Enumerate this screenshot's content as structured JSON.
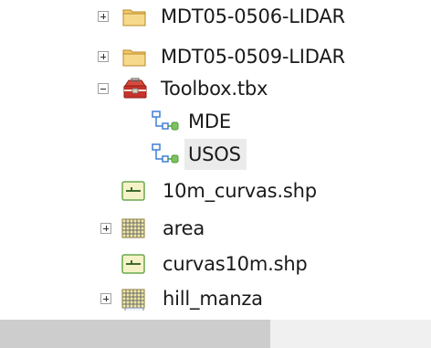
{
  "tree": {
    "items": [
      {
        "label": "MDT05-0506-LIDAR",
        "icon": "folder-icon",
        "expander": "plus"
      },
      {
        "label": "MDT05-0509-LIDAR",
        "icon": "folder-icon",
        "expander": "plus"
      },
      {
        "label": "Toolbox.tbx",
        "icon": "toolbox-icon",
        "expander": "minus"
      },
      {
        "label": "MDE",
        "icon": "model-icon",
        "expander": "none"
      },
      {
        "label": "USOS",
        "icon": "model-icon",
        "expander": "none",
        "selected": true
      },
      {
        "label": "10m_curvas.shp",
        "icon": "line-shapefile-icon",
        "expander": "none"
      },
      {
        "label": "area",
        "icon": "raster-icon",
        "expander": "plus"
      },
      {
        "label": "curvas10m.shp",
        "icon": "line-shapefile-icon",
        "expander": "none"
      },
      {
        "label": "hill_manza",
        "icon": "raster-icon",
        "expander": "plus"
      }
    ]
  },
  "colors": {
    "folder": "#f3c96a",
    "selection": "#ebebeb",
    "scroll_track": "#f0f0f0",
    "scroll_thumb": "#cdcdcd",
    "model_blue": "#3f7fd8",
    "model_green": "#4c9a3a"
  }
}
